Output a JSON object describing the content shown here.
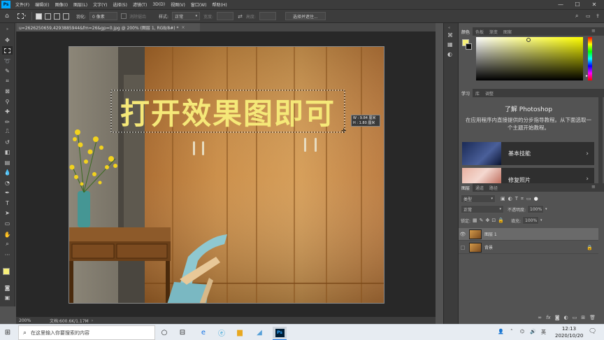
{
  "app": {
    "logo": "Ps"
  },
  "menu": [
    "文件(F)",
    "编辑(E)",
    "图像(I)",
    "图层(L)",
    "文字(Y)",
    "选择(S)",
    "滤镜(T)",
    "3D(D)",
    "视图(V)",
    "窗口(W)",
    "帮助(H)"
  ],
  "window_controls": {
    "minimize": "—",
    "maximize": "☐",
    "close": "✕"
  },
  "options": {
    "feather_label": "羽化:",
    "feather_value": "0 像素",
    "antialias_label": "消除锯齿",
    "style_label": "样式:",
    "style_value": "正常",
    "width_label": "宽度:",
    "height_label": "高度:",
    "select_mask_button": "选择并遮住..."
  },
  "document": {
    "tab_title": "u=2626250659,4293885944&fm=26&gp=0.jpg @ 200% (图层 1, RGB/8#) *",
    "tab_close": "×",
    "canvas_text": "打开效果图即可",
    "selection_w": "W : 9.84 厘米",
    "selection_h": "H : 1.80 厘米"
  },
  "status": {
    "zoom": "200%",
    "doc_info": "文档:600.6K/1.17M"
  },
  "panels": {
    "color_tabs": [
      "颜色",
      "色板",
      "渐变",
      "图案"
    ],
    "learn_tabs": [
      "学习",
      "库",
      "调整"
    ],
    "learn_title": "了解 Photoshop",
    "learn_desc": "在应用程序内直接提供的分步指导教程。从下面选取一个主题开始教程。",
    "learn_cards": [
      "基本技能",
      "修复照片"
    ],
    "layer_tabs": [
      "图层",
      "通道",
      "路径"
    ],
    "filter_kind": "类型",
    "blend_mode": "正常",
    "opacity_label": "不透明度:",
    "opacity_value": "100%",
    "lock_label": "锁定:",
    "fill_label": "填充:",
    "fill_value": "100%",
    "layers": [
      {
        "name": "图层 1",
        "visible": true,
        "selected": true
      },
      {
        "name": "背景",
        "visible": false,
        "selected": false,
        "locked": true
      }
    ]
  },
  "taskbar": {
    "search_placeholder": "在这里输入你要搜索的内容",
    "time": "12:13",
    "date": "2020/10/20",
    "ps_label": "Ps",
    "ime": "英"
  },
  "colors": {
    "foreground": "#f7f07a",
    "background": "#111111",
    "canvas_text": "#f5e878",
    "accent": "#1473e6"
  }
}
